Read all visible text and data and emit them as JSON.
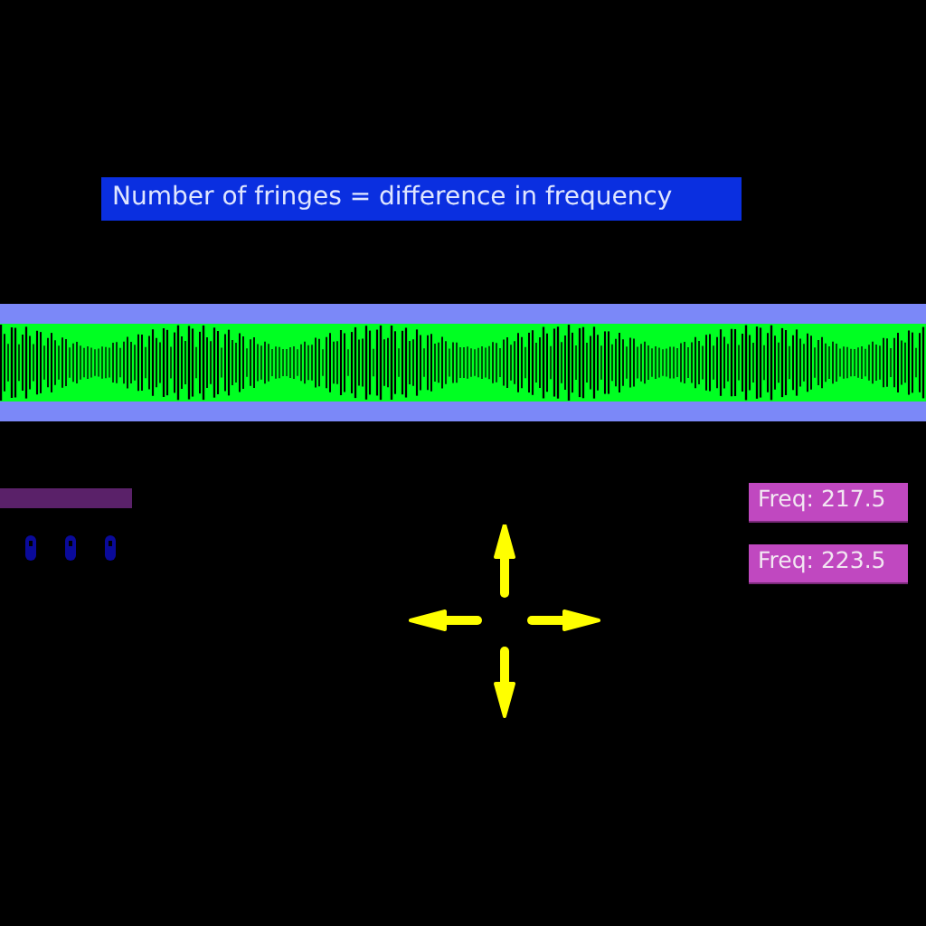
{
  "banner": {
    "text": "Number of fringes = difference in frequency"
  },
  "frequency_labels": [
    {
      "text": "Freq: 217.5"
    },
    {
      "text": "Freq: 223.5"
    }
  ]
}
